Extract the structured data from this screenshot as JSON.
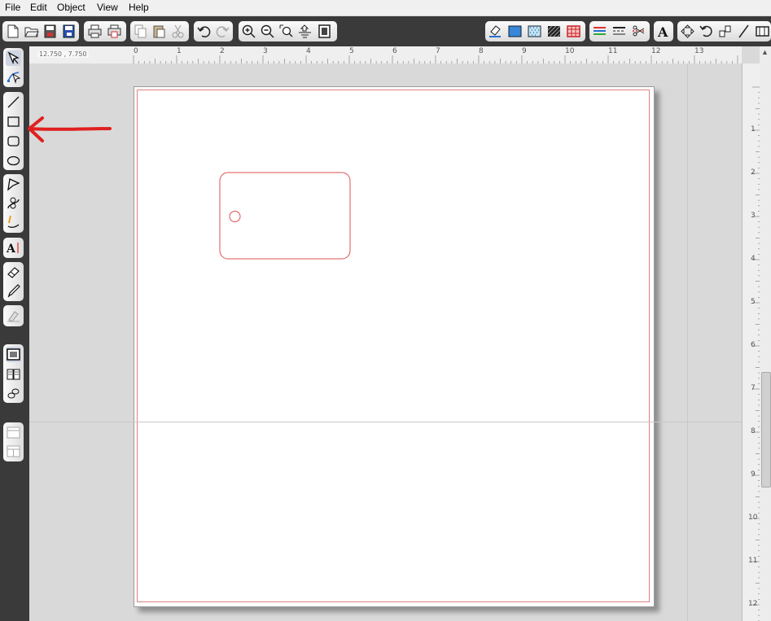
{
  "menu": {
    "items": [
      "File",
      "Edit",
      "Object",
      "View",
      "Help"
    ]
  },
  "ruler": {
    "coordinates": "12.750 , 7.750",
    "h_labels": [
      "0",
      "1",
      "2",
      "3",
      "4",
      "5",
      "6",
      "7",
      "8",
      "9",
      "10",
      "11",
      "12",
      "13"
    ],
    "v_labels": [
      "1",
      "2",
      "3",
      "4",
      "5",
      "6",
      "7",
      "8",
      "9",
      "10",
      "11",
      "12"
    ]
  },
  "colors": {
    "toolbar_bg": "#3a3a3a",
    "cut_line": "#e05050",
    "annotation_arrow": "#e02020"
  },
  "toolbar_icons": [
    "new-file-icon",
    "open-folder-icon",
    "save-icon",
    "save-as-icon",
    "print-icon",
    "cut-print-icon",
    "copy-icon",
    "paste-icon",
    "scissors-icon",
    "undo-icon",
    "redo-icon",
    "zoom-in-icon",
    "zoom-out-icon",
    "zoom-select-icon",
    "zoom-fit-icon",
    "zoom-page-icon",
    "eraser-fill-icon",
    "fill-solid-icon",
    "fill-pattern-icon",
    "fill-hatch-icon",
    "fill-registration-icon",
    "line-color-icon",
    "line-style-icon",
    "line-cut-icon",
    "text-style-icon",
    "align-icon",
    "rotate-icon",
    "mirror-icon",
    "slant-icon",
    "weld-icon"
  ],
  "sidebar_tools": [
    "select-tool-icon",
    "node-edit-tool-icon",
    "line-tool-icon",
    "rectangle-tool-icon",
    "rounded-rectangle-tool-icon",
    "ellipse-tool-icon",
    "polygon-tool-icon",
    "bezier-tool-icon",
    "freehand-tool-icon",
    "text-tool-icon",
    "eraser-tool-icon",
    "knife-tool-icon",
    "trace-tool-icon",
    "page-setup-icon",
    "library-icon",
    "link-icon",
    "panel-top-icon",
    "panel-split-icon"
  ]
}
